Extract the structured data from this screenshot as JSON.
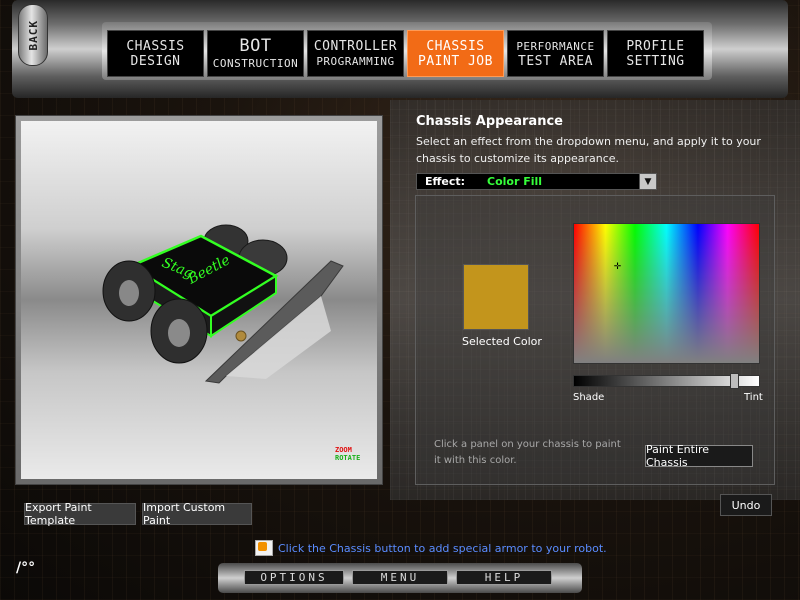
{
  "nav": {
    "back_label": "BACK",
    "tabs": [
      {
        "line1": "CHASSIS",
        "line2": "DESIGN"
      },
      {
        "line1": "BOT",
        "line2": "CONSTRUCTION"
      },
      {
        "line1": "CONTROLLER",
        "line2": "PROGRAMMING"
      },
      {
        "line1": "CHASSIS",
        "line2": "PAINT JOB"
      },
      {
        "line1": "PERFORMANCE",
        "line2": "TEST AREA"
      },
      {
        "line1": "PROFILE",
        "line2": "SETTING"
      }
    ],
    "active_tab": 3
  },
  "viewport": {
    "robot_name_line1": "Stag",
    "robot_name_line2": "Beetle",
    "zoom_label": "ZOOM",
    "rotate_label": "ROTATE"
  },
  "appearance": {
    "title": "Chassis Appearance",
    "description": "Select an effect from the dropdown menu, and apply it to your chassis to customize its appearance.",
    "effect_label": "Effect:",
    "effect_value": "Color Fill",
    "selected_color_label": "Selected Color",
    "selected_color": "#c3951c",
    "shade_label": "Shade",
    "tint_label": "Tint",
    "shade_tint_level": 0.88,
    "hint": "Click a panel on your chassis to paint it with this color.",
    "paint_all_label": "Paint Entire Chassis"
  },
  "actions": {
    "export_label": "Export Paint Template",
    "import_label": "Import Custom Paint",
    "undo_label": "Undo"
  },
  "tip": {
    "icon_text": "tips",
    "text": "Click the Chassis button to add special armor to your robot."
  },
  "bottom_nav": {
    "options": "OPTIONS",
    "menu": "MENU",
    "help": "HELP"
  },
  "logo_text": "/°°",
  "colors": {
    "accent_tab": "#f26b16",
    "effect_value": "#35ff3a",
    "tip_text": "#5a8cff",
    "chassis_outline": "#33ff22"
  }
}
